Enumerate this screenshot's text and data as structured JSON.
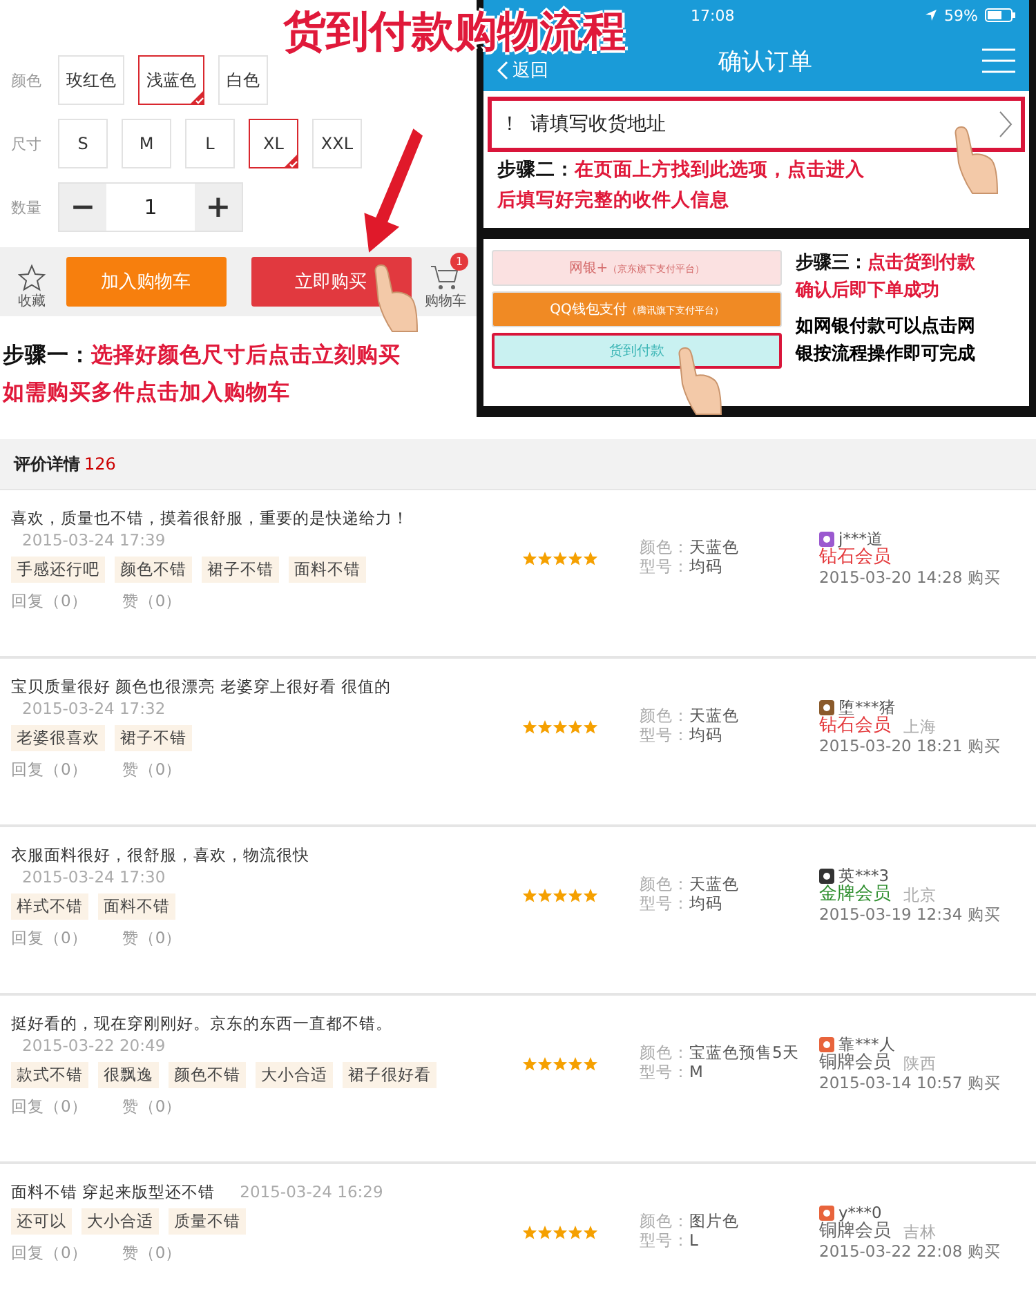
{
  "title": "货到付款购物流程",
  "product_options": {
    "rows": [
      {
        "label": "颜色",
        "kind": "options",
        "options": [
          {
            "label": "玫红色",
            "selected": false
          },
          {
            "label": "浅蓝色",
            "selected": true
          },
          {
            "label": "白色",
            "selected": false
          }
        ]
      },
      {
        "label": "尺寸",
        "kind": "options",
        "options": [
          {
            "label": "S",
            "selected": false
          },
          {
            "label": "M",
            "selected": false
          },
          {
            "label": "L",
            "selected": false
          },
          {
            "label": "XL",
            "selected": true
          },
          {
            "label": "XXL",
            "selected": false
          }
        ]
      },
      {
        "label": "数量",
        "kind": "stepper",
        "minus": "−",
        "value": "1",
        "plus": "+"
      }
    ]
  },
  "action_bar": {
    "favorite": "收藏",
    "add_to_cart": "加入购物车",
    "buy_now": "立即购买",
    "cart": "购物车",
    "cart_badge": "1"
  },
  "step_one": {
    "label": "步骤一：",
    "lines": [
      "选择好颜色尺寸后点击立刻购买",
      "如需购买多件点击加入购物车"
    ]
  },
  "phone": {
    "time": "17:08",
    "battery": "59%",
    "back": "返回",
    "nav_title": "确认订单",
    "address_mark": "！",
    "address": "请填写收货地址"
  },
  "step_two": {
    "label": "步骤二：",
    "lines": [
      "在页面上方找到此选项，点击进入",
      "后填写好完整的收件人信息"
    ]
  },
  "payment_methods": [
    {
      "name": "网银+",
      "note": "（京东旗下支付平台）",
      "kind": "bank",
      "selected": false
    },
    {
      "name": "QQ钱包支付",
      "note": "（腾讯旗下支付平台）",
      "kind": "wallet",
      "selected": false
    },
    {
      "name": "货到付款",
      "kind": "cod",
      "selected": true
    }
  ],
  "step_three": {
    "label": "步骤三：",
    "lines": [
      "点击货到付款",
      "确认后即下单成功"
    ],
    "notes": [
      "如网银付款可以点击网",
      "银按流程操作即可完成"
    ]
  },
  "reviews_header": {
    "title": "评价详情",
    "count": "126"
  },
  "reviews": [
    {
      "text": "喜欢，质量也不错，摸着很舒服，重要的是快递给力！",
      "date": "2015-03-24 17:39",
      "date_inline": false,
      "tags": [
        "手感还行吧",
        "颜色不错",
        "裙子不错",
        "面料不错"
      ],
      "reply": "回复（0）",
      "like": "赞（0）",
      "stars": 5,
      "color_label": "颜色：",
      "color_value": "天蓝色",
      "size_label": "型号：",
      "size_value": "均码",
      "user": "j***道",
      "avatar": {
        "color": "#9b59d0"
      },
      "member": {
        "label": "钻石会员",
        "color": "#e4393c"
      },
      "bought": "2015-03-20 14:28 购买"
    },
    {
      "text": "宝贝质量很好 颜色也很漂亮 老婆穿上很好看 很值的",
      "date": "2015-03-24 17:32",
      "date_inline": false,
      "tags": [
        "老婆很喜欢",
        "裙子不错"
      ],
      "reply": "回复（0）",
      "like": "赞（0）",
      "stars": 5,
      "color_label": "颜色：",
      "color_value": "天蓝色",
      "size_label": "型号：",
      "size_value": "均码",
      "user": "堕***猪",
      "avatar": {
        "color": "#8a5a2b"
      },
      "member": {
        "label": "钻石会员",
        "color": "#e4393c"
      },
      "region": "上海",
      "bought": "2015-03-20 18:21 购买"
    },
    {
      "text": "衣服面料很好，很舒服，喜欢，物流很快",
      "date": "2015-03-24 17:30",
      "date_inline": false,
      "tags": [
        "样式不错",
        "面料不错"
      ],
      "reply": "回复（0）",
      "like": "赞（0）",
      "stars": 5,
      "color_label": "颜色：",
      "color_value": "天蓝色",
      "size_label": "型号：",
      "size_value": "均码",
      "user": "英***3",
      "avatar": {
        "color": "#333333"
      },
      "member": {
        "label": "金牌会员",
        "color": "#2f8f2f"
      },
      "region": "北京",
      "bought": "2015-03-19 12:34 购买"
    },
    {
      "text": "挺好看的，现在穿刚刚好。京东的东西一直都不错。",
      "date": "2015-03-22 20:49",
      "date_inline": false,
      "tags": [
        "款式不错",
        "很飘逸",
        "颜色不错",
        "大小合适",
        "裙子很好看"
      ],
      "reply": "回复（0）",
      "like": "赞（0）",
      "stars": 5,
      "color_label": "颜色：",
      "color_value": "宝蓝色预售5天",
      "size_label": "型号：",
      "size_value": "M",
      "user": "靠***人",
      "avatar": {
        "color": "#e8643c"
      },
      "member": {
        "label": "铜牌会员",
        "color": "#666666"
      },
      "region": "陕西",
      "bought": "2015-03-14 10:57 购买"
    },
    {
      "text": "面料不错 穿起来版型还不错",
      "date": "2015-03-24 16:29",
      "date_inline": true,
      "tags": [
        "还可以",
        "大小合适",
        "质量不错"
      ],
      "reply": "回复（0）",
      "like": "赞（0）",
      "stars": 5,
      "color_label": "颜色：",
      "color_value": "图片色",
      "size_label": "型号：",
      "size_value": "L",
      "user": "y***0",
      "avatar": {
        "color": "#e8643c"
      },
      "member": {
        "label": "铜牌会员",
        "color": "#666666"
      },
      "region": "吉林",
      "bought": "2015-03-22 22:08 购买"
    }
  ]
}
